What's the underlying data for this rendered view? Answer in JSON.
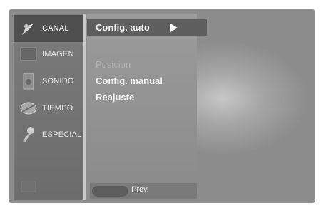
{
  "menu": {
    "items": [
      {
        "label": "CANAL",
        "icon": "antenna-icon",
        "active": true
      },
      {
        "label": "IMAGEN",
        "icon": "picture-icon",
        "active": false
      },
      {
        "label": "SONIDO",
        "icon": "speaker-icon",
        "active": false
      },
      {
        "label": "TIEMPO",
        "icon": "clock-icon",
        "active": false
      },
      {
        "label": "ESPECIAL",
        "icon": "key-icon",
        "active": false
      },
      {
        "label": "",
        "icon": "screen-icon",
        "active": false
      }
    ]
  },
  "submenu": {
    "items": [
      {
        "label": "Config. auto",
        "selected": true
      },
      {
        "label": "",
        "dim": true
      },
      {
        "label": "Posicion",
        "dim": true
      },
      {
        "label": "Config. manual",
        "dim": false
      },
      {
        "label": "Reajuste",
        "dim": false
      }
    ]
  },
  "footer": {
    "prev_label": "Prev."
  },
  "colors": {
    "panel": "#6c6c6c",
    "selected": "#5e5e5e",
    "text": "#ffffff"
  }
}
